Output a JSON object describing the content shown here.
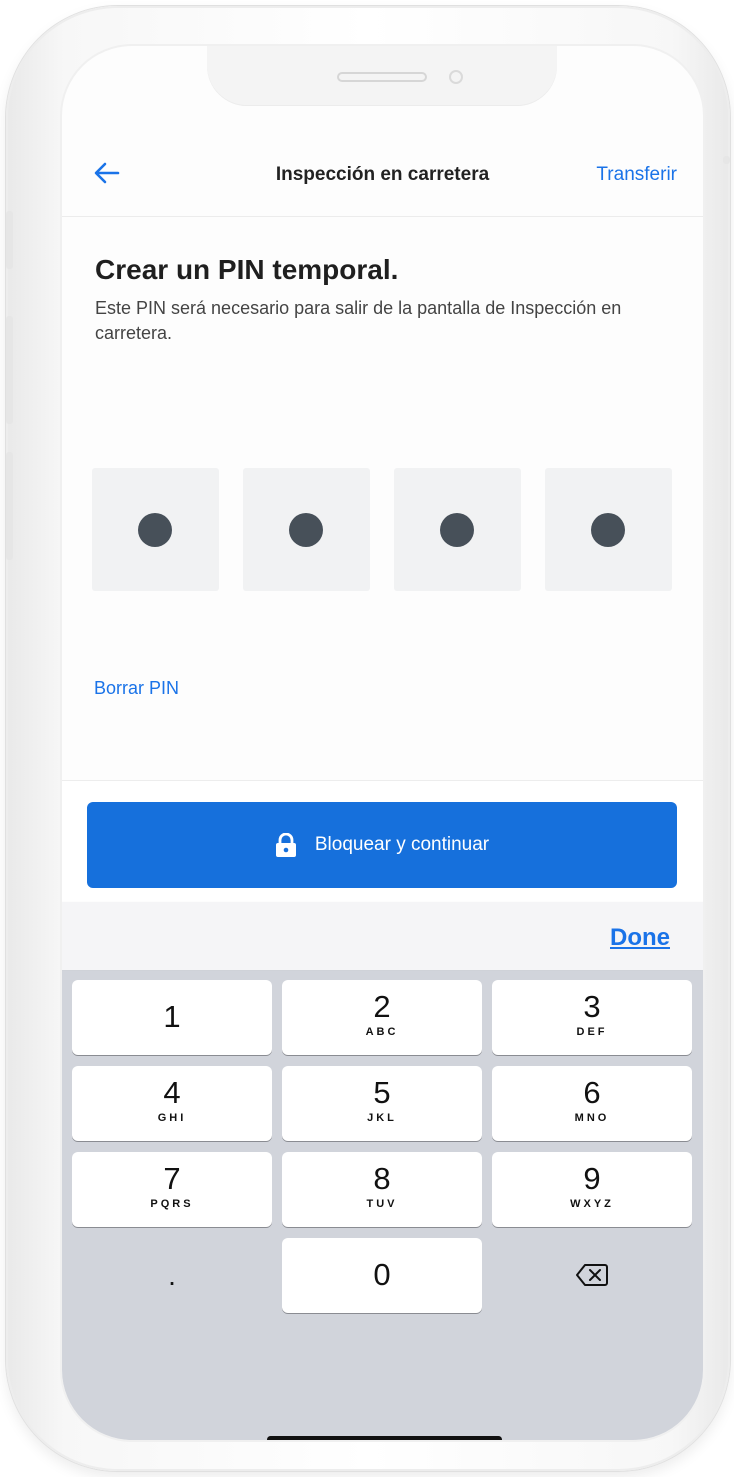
{
  "nav": {
    "title": "Inspección en carretera",
    "action": "Transferir",
    "back_icon": "arrow-left-icon"
  },
  "content": {
    "heading": "Crear un PIN temporal.",
    "description": "Este PIN será necesario para salir de la pantalla de Inspección en carretera.",
    "pin_entered_digits": 4,
    "clear_link": "Borrar PIN"
  },
  "primary_button": {
    "label": "Bloquear y continuar",
    "icon": "lock-icon"
  },
  "keyboard": {
    "done_label": "Done",
    "keys": [
      {
        "digit": "1",
        "letters": ""
      },
      {
        "digit": "2",
        "letters": "ABC"
      },
      {
        "digit": "3",
        "letters": "DEF"
      },
      {
        "digit": "4",
        "letters": "GHI"
      },
      {
        "digit": "5",
        "letters": "JKL"
      },
      {
        "digit": "6",
        "letters": "MNO"
      },
      {
        "digit": "7",
        "letters": "PQRS"
      },
      {
        "digit": "8",
        "letters": "TUV"
      },
      {
        "digit": "9",
        "letters": "WXYZ"
      },
      {
        "digit": "0",
        "letters": ""
      }
    ],
    "dot_key": ".",
    "delete_icon": "backspace-icon"
  },
  "colors": {
    "accent": "#1a73e8",
    "primary_button": "#1670dc",
    "pin_dot": "#475059",
    "keyboard_bg": "#d1d4db"
  }
}
